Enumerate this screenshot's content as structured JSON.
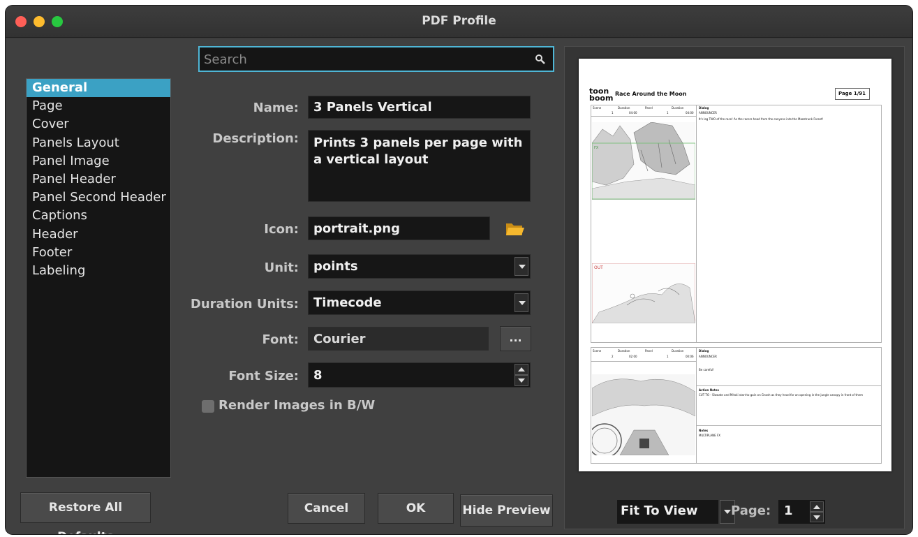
{
  "window": {
    "title": "PDF Profile"
  },
  "categories": [
    "General",
    "Page",
    "Cover",
    "Panels Layout",
    "Panel Image",
    "Panel Header",
    "Panel Second Header",
    "Captions",
    "Header",
    "Footer",
    "Labeling"
  ],
  "selected_category": "General",
  "search": {
    "placeholder": "Search",
    "value": ""
  },
  "form": {
    "name_label": "Name:",
    "name_value": "3 Panels Vertical",
    "description_label": "Description:",
    "description_value": "Prints 3 panels per page with a vertical layout",
    "icon_label": "Icon:",
    "icon_value": "portrait.png",
    "unit_label": "Unit:",
    "unit_value": "points",
    "duration_units_label": "Duration Units:",
    "duration_units_value": "Timecode",
    "font_label": "Font:",
    "font_value": "Courier",
    "font_button": "...",
    "font_size_label": "Font Size:",
    "font_size_value": "8",
    "render_bw_label": "Render Images in B/W",
    "render_bw_checked": false
  },
  "buttons": {
    "restore": "Restore All Defaults",
    "cancel": "Cancel",
    "ok": "OK",
    "hide_preview": "Hide Preview"
  },
  "preview": {
    "logo_top": "toon",
    "logo_bottom": "boom",
    "project_title": "Race Around the Moon",
    "page_indicator": "Page 1/91",
    "scene_label": "Scene",
    "duration_label": "Duration",
    "panel_label": "Panel",
    "panel1": {
      "scene": "1",
      "duration": "04:00",
      "panel": "1",
      "total": "04:00",
      "dialog_title": "Dialog",
      "speaker": "ANNOUNCER",
      "dialog": "It's leg TWO of the race! As the racers head from the canyons into the Mazetrunk Forest!",
      "fx_tag": "FX",
      "out_tag": "OUT"
    },
    "panel2": {
      "scene": "2",
      "duration": "02:00",
      "panel": "1",
      "total": "00:06",
      "dialog_title": "Dialog",
      "speaker": "ANNOUNCER",
      "dialog": "Be careful!",
      "action_title": "Action Notes",
      "action": "CUT TO - Slowate and Mitski start to gain on Gnosh as they head for an opening in the jungle canopy in front of them",
      "notes_title": "Notes",
      "notes": "MULTIPLANE FX"
    },
    "zoom_value": "Fit To View",
    "page_label": "Page:",
    "page_value": "1"
  },
  "colors": {
    "selection": "#3ba1c4",
    "search_focus": "#4fb6d6",
    "folder_icon": "#f5b82e"
  }
}
